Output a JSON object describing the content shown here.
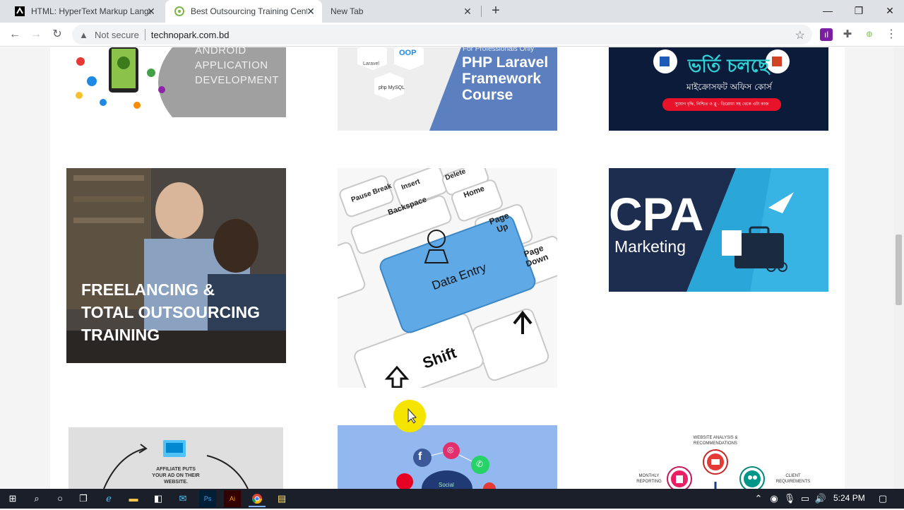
{
  "browser": {
    "tabs": [
      {
        "label": "HTML: HyperText Markup Langua",
        "favicon": "mdn-icon"
      },
      {
        "label": "Best Outsourcing Training Cente",
        "favicon": "technopark-icon"
      },
      {
        "label": "New Tab",
        "favicon": ""
      }
    ],
    "new_tab_label": "+",
    "url_security": "Not secure",
    "url": "technopark.com.bd"
  },
  "page": {
    "cards": [
      {
        "id": "android",
        "text_lines": [
          "ANDROID",
          "APPLICATION",
          "DEVELOPMENT"
        ]
      },
      {
        "id": "laravel",
        "eyebrow": "For Professionals Only",
        "text_lines": [
          "PHP Laravel",
          "Framework",
          "Course"
        ],
        "tags": [
          "Laravel",
          "OOP",
          "php MySQL"
        ]
      },
      {
        "id": "office",
        "headline": "ভর্তি চলছে",
        "subline": "মাইক্রোসফট অফিস কোর্স",
        "pill": "সুযোগ বৃদ্ধি, নিশ্চিত ও ব্লু - ডিপ্লোমা সহ থেকে এটা কাজ"
      },
      {
        "id": "freelancing",
        "text_lines": [
          "FREELANCING &",
          "TOTAL OUTSOURCING",
          "TRAINING"
        ]
      },
      {
        "id": "dataentry",
        "keys": [
          "Pause Break",
          "Insert",
          "Delete",
          "Home",
          "Backspace",
          "Page Up",
          "Page Down",
          "Data Entry",
          "Shift"
        ]
      },
      {
        "id": "cpa",
        "title": "CPA",
        "subtitle": "Marketing"
      },
      {
        "id": "affiliate",
        "caption": "AFFILIATE PUTS YOUR AD ON THEIR WEBSITE."
      },
      {
        "id": "social",
        "label": "Social"
      },
      {
        "id": "seo",
        "labels": [
          "WEBSITE ANALYSIS & RECOMMENDATIONS",
          "MONTHLY REPORTING",
          "CLIENT REQUIREMENTS"
        ]
      }
    ]
  },
  "taskbar": {
    "time": "5:24 PM"
  },
  "colors": {
    "accent_blue": "#4a90d9",
    "cpa_navy": "#1d2d50",
    "office_navy": "#0c1b3a",
    "laravel_blue": "#5b7fbf"
  }
}
